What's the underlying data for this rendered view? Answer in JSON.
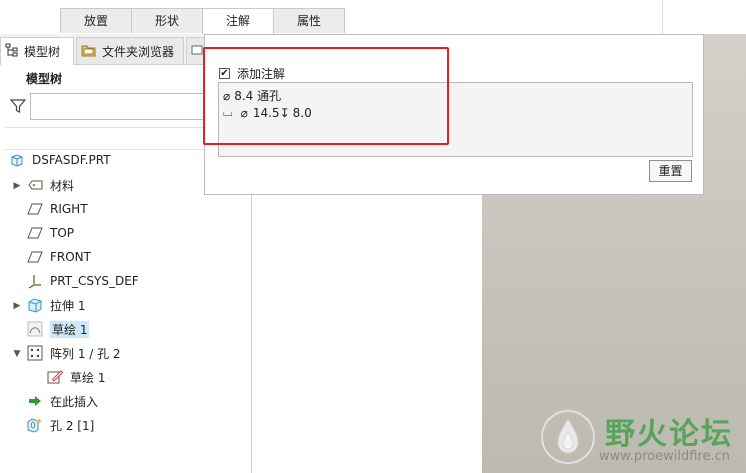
{
  "ribbon_tabs": [
    {
      "label": "放置",
      "active": false
    },
    {
      "label": "形状",
      "active": false
    },
    {
      "label": "注解",
      "active": true
    },
    {
      "label": "属性",
      "active": false
    }
  ],
  "left_panel": {
    "tabs": [
      {
        "label": "模型树",
        "icon": "model-tree-icon"
      },
      {
        "label": "文件夹浏览器",
        "icon": "folder-browser-icon"
      }
    ],
    "header": "模型树",
    "filter_placeholder": ""
  },
  "tree": [
    {
      "label": "DSFASDF.PRT",
      "icon": "part-icon",
      "expandable": false,
      "expanded": false,
      "highlighted": false
    },
    {
      "label": "材料",
      "icon": "material-icon",
      "expandable": true,
      "expanded": false,
      "highlighted": false
    },
    {
      "label": "RIGHT",
      "icon": "datum-plane-icon",
      "expandable": false,
      "expanded": false,
      "highlighted": false
    },
    {
      "label": "TOP",
      "icon": "datum-plane-icon",
      "expandable": false,
      "expanded": false,
      "highlighted": false
    },
    {
      "label": "FRONT",
      "icon": "datum-plane-icon",
      "expandable": false,
      "expanded": false,
      "highlighted": false
    },
    {
      "label": "PRT_CSYS_DEF",
      "icon": "csys-icon",
      "expandable": false,
      "expanded": false,
      "highlighted": false
    },
    {
      "label": "拉伸 1",
      "icon": "extrude-icon",
      "expandable": true,
      "expanded": false,
      "highlighted": false
    },
    {
      "label": "草绘 1",
      "icon": "sketch-icon",
      "expandable": false,
      "expanded": false,
      "highlighted": true
    },
    {
      "label": "阵列 1 / 孔 2",
      "icon": "pattern-icon",
      "expandable": true,
      "expanded": true,
      "highlighted": false
    },
    {
      "label": "草绘 1",
      "icon": "sketch-edit-icon",
      "expandable": false,
      "expanded": false,
      "highlighted": false
    },
    {
      "label": "在此插入",
      "icon": "insert-here-arrow-icon",
      "expandable": false,
      "expanded": false,
      "highlighted": false
    },
    {
      "label": "孔 2 [1]",
      "icon": "hole-icon",
      "expandable": false,
      "expanded": false,
      "highlighted": false
    }
  ],
  "popup": {
    "checkbox_label": "添加注解",
    "checkbox_checked": true,
    "note_line1": {
      "symbol": "⌀",
      "text": "8.4 通孔"
    },
    "note_line2": {
      "counterbore_symbol": "⌴",
      "diameter_symbol": "⌀",
      "diameter": "14.5",
      "depth_symbol": "↧",
      "depth": "8.0"
    },
    "reset_label": "重置"
  },
  "watermark": {
    "title": "野火论坛",
    "url": "www.proewildfire.cn"
  },
  "colors": {
    "highlight": "#cde8fb",
    "annotation_box": "#e2211c",
    "graphics_bg": "#c8c6bd",
    "watermark_green": "#58a45a"
  }
}
